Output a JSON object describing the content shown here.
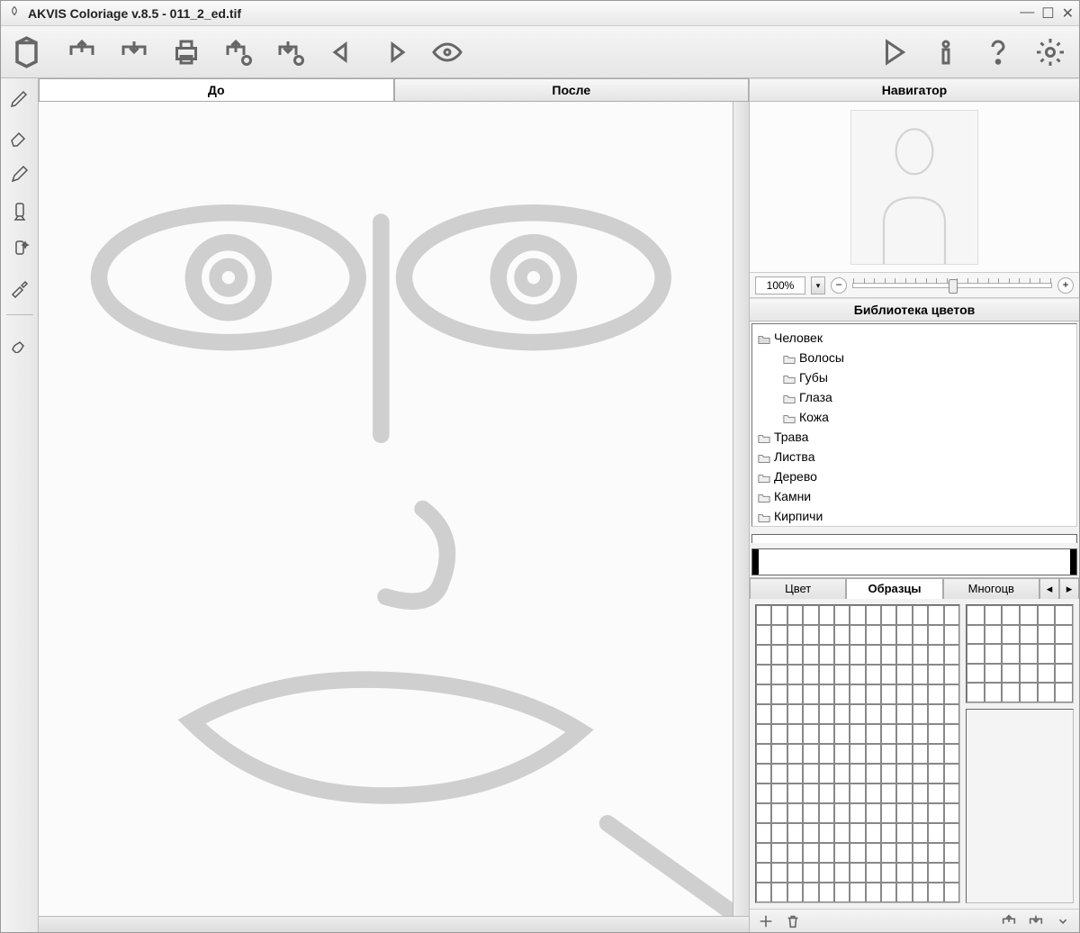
{
  "window": {
    "title": "AKVIS Coloriage v.8.5 - 011_2_ed.tif"
  },
  "toolbar": {
    "icons": [
      "bucket",
      "open",
      "save",
      "print",
      "import-settings",
      "export-settings",
      "undo",
      "redo",
      "preview-eye"
    ],
    "right_icons": [
      "run",
      "info",
      "help",
      "settings"
    ]
  },
  "left_tools": [
    "pencil-plus",
    "eraser",
    "pen",
    "tube",
    "tube-sparkle",
    "dropper",
    "sep",
    "brush"
  ],
  "main_tabs": {
    "before": "До",
    "after": "После",
    "active": "before"
  },
  "navigator": {
    "title": "Навигатор"
  },
  "zoom": {
    "value": "100%"
  },
  "library": {
    "title": "Библиотека цветов",
    "tree": [
      {
        "label": "Человек",
        "children": [
          {
            "label": "Волосы"
          },
          {
            "label": "Губы"
          },
          {
            "label": "Глаза"
          },
          {
            "label": "Кожа"
          }
        ]
      },
      {
        "label": "Трава"
      },
      {
        "label": "Листва"
      },
      {
        "label": "Дерево"
      },
      {
        "label": "Камни"
      },
      {
        "label": "Кирпичи"
      }
    ]
  },
  "color_tabs": {
    "color": "Цвет",
    "swatches": "Образцы",
    "multi": "Многоцв",
    "active": "swatches"
  },
  "footer_icons": [
    "add",
    "delete",
    "load",
    "save-down",
    "menu"
  ]
}
